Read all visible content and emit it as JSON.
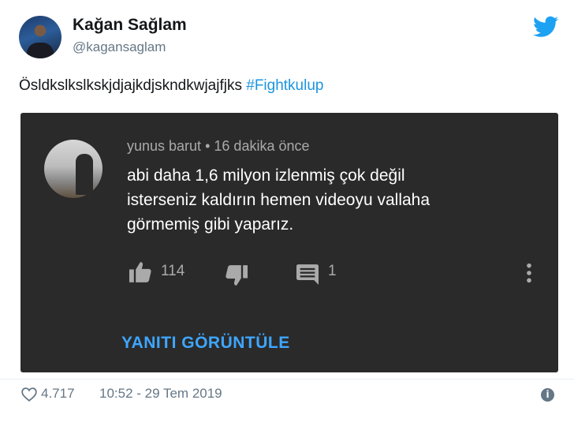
{
  "tweet": {
    "author_name": "Kağan Sağlam",
    "author_handle": "@kagansaglam",
    "text": "Ösldkslkslkskjdjajkdjskndkwjajfjks ",
    "hashtag": "#Fightkulup",
    "like_count": "4.717",
    "timestamp": "10:52 - 29 Tem 2019",
    "icons": [
      "avatar",
      "twitter-bird-icon",
      "heart-icon",
      "info-icon"
    ],
    "colors": {
      "hashtag": "#1b95e0",
      "bird": "#1da1f2",
      "secondary_text": "#657786"
    }
  },
  "embedded_comment": {
    "author": "yunus barut",
    "separator": "•",
    "time_ago": "16 dakika önce",
    "text_lines": [
      "abi daha 1,6 milyon izlenmiş çok değil",
      "isterseniz kaldırın hemen videoyu vallaha",
      "görmemiş gibi yaparız."
    ],
    "like_count": "114",
    "reply_count": "1",
    "view_replies_label": "YANITI GÖRÜNTÜLE",
    "icons": [
      "thumbs-up-icon",
      "thumbs-down-icon",
      "reply-comment-icon",
      "more-vertical-icon"
    ],
    "colors": {
      "background": "#2a2a2a",
      "link": "#3ea6ff"
    }
  }
}
